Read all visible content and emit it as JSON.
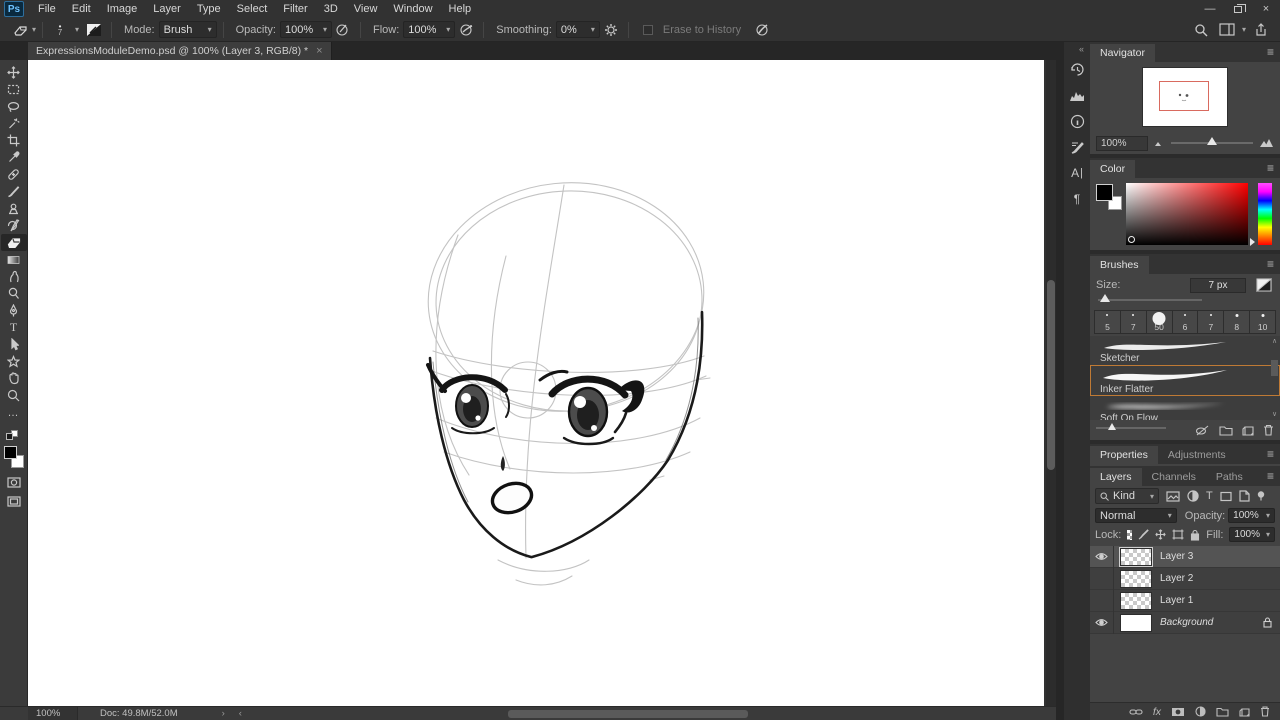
{
  "icons": {
    "caret": "▾",
    "hamburger": "≡",
    "close": "×",
    "minimize": "—",
    "collapse": "«",
    "ellipsis": "…",
    "chevron_right": "›",
    "chevron_left": "‹",
    "arrow_up": "∧",
    "arrow_down": "∨",
    "character_A": "A",
    "paragraph": "¶",
    "type_T": "T",
    "fx": "fx"
  },
  "app": {
    "logo": "Ps"
  },
  "menubar": {
    "items": [
      "File",
      "Edit",
      "Image",
      "Layer",
      "Type",
      "Select",
      "Filter",
      "3D",
      "View",
      "Window",
      "Help"
    ]
  },
  "options_bar": {
    "tool_preset_size": "7",
    "mode_label": "Mode:",
    "mode_value": "Brush",
    "opacity_label": "Opacity:",
    "opacity_value": "100%",
    "flow_label": "Flow:",
    "flow_value": "100%",
    "smoothing_label": "Smoothing:",
    "smoothing_value": "0%",
    "erase_history_label": "Erase to History"
  },
  "document_tab": {
    "title": "ExpressionsModuleDemo.psd @ 100% (Layer 3, RGB/8) *"
  },
  "toolbar": {
    "selected_tool": "eraser",
    "tools": [
      "move",
      "rectangular-marquee",
      "lasso",
      "quick-selection",
      "crop",
      "eyedropper",
      "spot-healing-brush",
      "brush",
      "clone-stamp",
      "history-brush",
      "eraser",
      "gradient",
      "smudge",
      "dodge",
      "pen",
      "type",
      "path-selection",
      "custom-shape",
      "hand",
      "zoom",
      "edit-toolbar"
    ]
  },
  "dock_strip": {
    "panels": [
      "history",
      "histogram",
      "info",
      "brush-settings",
      "character",
      "paragraph"
    ]
  },
  "navigator": {
    "tab": "Navigator",
    "zoom_value": "100%"
  },
  "color_panel": {
    "tab": "Color"
  },
  "brushes_panel": {
    "tab": "Brushes",
    "size_label": "Size:",
    "size_value": "7 px",
    "preset_sizes": [
      "5",
      "7",
      "50",
      "6",
      "7",
      "8",
      "10"
    ],
    "brushes": [
      {
        "name": "Sketcher"
      },
      {
        "name": "Inker Flatter"
      },
      {
        "name": "Soft On Flow"
      }
    ],
    "selected_brush": "Inker Flatter"
  },
  "properties_dock": {
    "tabs": [
      "Properties",
      "Adjustments"
    ]
  },
  "layers_panel": {
    "tabs": [
      "Layers",
      "Channels",
      "Paths"
    ],
    "kind_value": "Kind",
    "blend_mode": "Normal",
    "opacity_label": "Opacity:",
    "opacity_value": "100%",
    "lock_label": "Lock:",
    "fill_label": "Fill:",
    "fill_value": "100%",
    "layers": [
      {
        "name": "Layer 3",
        "visible": true,
        "selected": true
      },
      {
        "name": "Layer 2",
        "visible": false
      },
      {
        "name": "Layer 1",
        "visible": false
      },
      {
        "name": "Background",
        "visible": true,
        "locked": true
      }
    ]
  },
  "status_bar": {
    "zoom": "100%",
    "doc_info": "Doc: 49.8M/52.0M"
  },
  "colors": {
    "accent_orange": "#bf7a35",
    "navigator_viewbox": "#d96a5f",
    "selected_row": "#545454",
    "canvas": "#ffffff"
  }
}
